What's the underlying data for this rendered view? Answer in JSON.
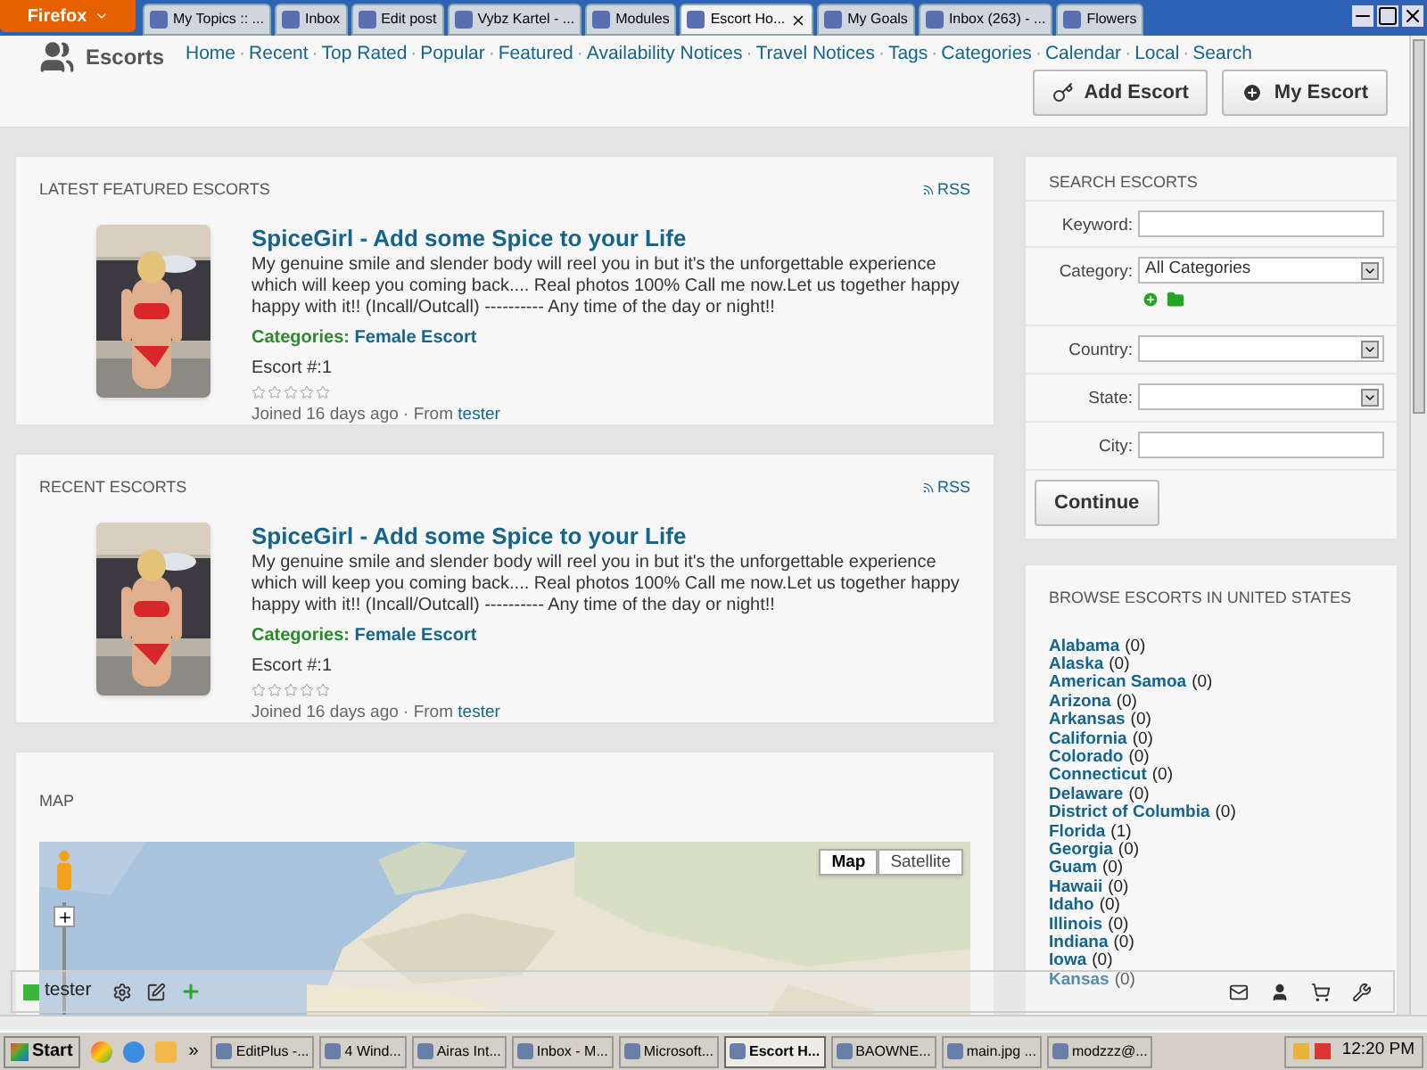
{
  "browser": {
    "menu_button": "Firefox",
    "tabs": [
      {
        "label": "My Topics :: ...",
        "selected": false
      },
      {
        "label": "Inbox",
        "selected": false
      },
      {
        "label": "Edit post",
        "selected": false
      },
      {
        "label": "Vybz Kartel - ...",
        "selected": false
      },
      {
        "label": "Modules",
        "selected": false
      },
      {
        "label": "Escort Ho...",
        "selected": true
      },
      {
        "label": "My Goals",
        "selected": false
      },
      {
        "label": "Inbox (263) - ...",
        "selected": false
      },
      {
        "label": "Flowers",
        "selected": false
      }
    ]
  },
  "header": {
    "site_title": "Escorts",
    "nav_separator": "·",
    "nav": [
      "Home",
      "Recent",
      "Top Rated",
      "Popular",
      "Featured",
      "Availability Notices",
      "Travel Notices",
      "Tags",
      "Categories",
      "Calendar",
      "Local",
      "Search"
    ],
    "buttons": [
      {
        "label": "Add Escort",
        "kind": "add"
      },
      {
        "label": "My Escort",
        "kind": "mine"
      }
    ]
  },
  "sections": [
    {
      "heading": "LATEST FEATURED ESCORTS",
      "rss": "RSS",
      "listing": {
        "title": "SpiceGirl - Add some Spice to your Life",
        "description": "My genuine smile and slender body will reel you in but it's the unforgettable experience which will keep you coming back.... Real photos 100% Call me now.Let us together happy happy with it!! (Incall/Outcall) ---------- Any time of the day or night!!",
        "categories_label": "Categories:",
        "category": "Female Escort",
        "number": "Escort #:1",
        "stars": 0,
        "joined": "Joined 16 days ago · From",
        "author": "tester"
      }
    },
    {
      "heading": "RECENT ESCORTS",
      "rss": "RSS",
      "listing": {
        "title": "SpiceGirl - Add some Spice to your Life",
        "description": "My genuine smile and slender body will reel you in but it's the unforgettable experience which will keep you coming back.... Real photos 100% Call me now.Let us together happy happy with it!! (Incall/Outcall) ---------- Any time of the day or night!!",
        "categories_label": "Categories:",
        "category": "Female Escort",
        "number": "Escort #:1",
        "stars": 0,
        "joined": "Joined 16 days ago · From",
        "author": "tester"
      }
    }
  ],
  "map": {
    "heading": "MAP",
    "map_types": [
      {
        "label": "Map",
        "selected": true
      },
      {
        "label": "Satellite",
        "selected": false
      }
    ]
  },
  "search": {
    "heading": "SEARCH ESCORTS",
    "fields": [
      {
        "label": "Keyword:",
        "kind": "text"
      },
      {
        "label": "Category:",
        "kind": "select",
        "value": "All Categories",
        "extras": true
      },
      {
        "label": "Country:",
        "kind": "select"
      },
      {
        "label": "State:",
        "kind": "select"
      },
      {
        "label": "City:",
        "kind": "text"
      }
    ],
    "button": "Continue"
  },
  "browse": {
    "heading": "BROWSE ESCORTS IN UNITED STATES",
    "states": [
      {
        "name": "Alabama",
        "count": "(0)"
      },
      {
        "name": "Alaska",
        "count": "(0)"
      },
      {
        "name": "American Samoa",
        "count": "(0)"
      },
      {
        "name": "Arizona",
        "count": "(0)"
      },
      {
        "name": "Arkansas",
        "count": "(0)"
      },
      {
        "name": "California",
        "count": "(0)"
      },
      {
        "name": "Colorado",
        "count": "(0)"
      },
      {
        "name": "Connecticut",
        "count": "(0)"
      },
      {
        "name": "Delaware",
        "count": "(0)"
      },
      {
        "name": "District of Columbia",
        "count": "(0)"
      },
      {
        "name": "Florida",
        "count": "(1)"
      },
      {
        "name": "Georgia",
        "count": "(0)"
      },
      {
        "name": "Guam",
        "count": "(0)"
      },
      {
        "name": "Hawaii",
        "count": "(0)"
      },
      {
        "name": "Idaho",
        "count": "(0)"
      },
      {
        "name": "Illinois",
        "count": "(0)"
      },
      {
        "name": "Indiana",
        "count": "(0)"
      },
      {
        "name": "Iowa",
        "count": "(0)"
      },
      {
        "name": "Kansas",
        "count": "(0)"
      }
    ]
  },
  "toolbar": {
    "user": "tester"
  },
  "taskbar": {
    "start": "Start",
    "more": "»",
    "tasks": [
      {
        "label": "EditPlus -...",
        "selected": false
      },
      {
        "label": "4 Wind...",
        "selected": false
      },
      {
        "label": "Airas Int...",
        "selected": false
      },
      {
        "label": "Inbox - M...",
        "selected": false
      },
      {
        "label": "Microsoft...",
        "selected": false
      },
      {
        "label": "Escort H...",
        "selected": true
      },
      {
        "label": "BAOWNE...",
        "selected": false
      },
      {
        "label": "main.jpg ...",
        "selected": false
      },
      {
        "label": "modzzz@...",
        "selected": false
      }
    ],
    "clock": "12:20 PM"
  }
}
